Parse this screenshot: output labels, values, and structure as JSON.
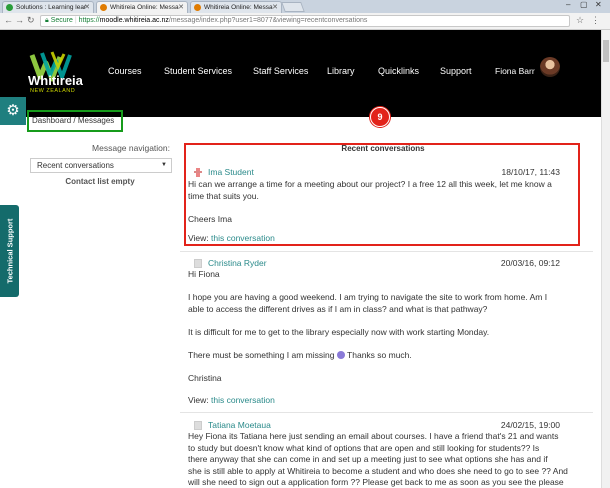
{
  "browser": {
    "tabs": [
      {
        "title": "Solutions : Learning lear",
        "fav": "#2a9d3a"
      },
      {
        "title": "Whitireia Online: Messa",
        "fav": "#e07b00"
      },
      {
        "title": "Whitireia Online: Messa",
        "fav": "#e07b00"
      }
    ],
    "url_secure": "Secure",
    "url_scheme": "https://",
    "url_host": "moodle.whitireia.ac.nz",
    "url_path": "/message/index.php?user1=8077&viewing=recentconversations"
  },
  "header": {
    "logo_text": "Whitireia",
    "logo_subtext": "NEW ZEALAND",
    "nav": [
      "Courses",
      "Student Services",
      "Staff Services",
      "Library",
      "Quicklinks",
      "Support"
    ],
    "user_name": "Fiona Barr"
  },
  "sidebar": {
    "support_label": "Technical Support"
  },
  "breadcrumb": {
    "home": "Dashboard",
    "separator": "/",
    "current": "Messages"
  },
  "message_nav": {
    "label": "Message navigation:",
    "selected": "Recent conversations",
    "empty_text": "Contact list empty"
  },
  "recent": {
    "title": "Recent conversations",
    "badge": "9",
    "view_prefix": "View:",
    "view_link": "this conversation",
    "messages": [
      {
        "sender": "Ima Student",
        "date": "18/10/17, 11:43",
        "lines": [
          "Hi can we arrange a time for a meeting about our project? I a free 12 all this week, let me know a",
          "time that suits you.",
          "",
          "Cheers Ima"
        ]
      },
      {
        "sender": "Christina Ryder",
        "date": "20/03/16, 09:12",
        "lines": [
          "Hi Fiona",
          "",
          "I hope you are having a good weekend. I am trying to navigate the site to work from home. Am I",
          "able to access the different drives as if I am in class? and what is that pathway?",
          "",
          "It is difficult for me to get to the library especially now with work starting Monday.",
          "",
          "There must be something I am missing",
          "",
          "Christina"
        ],
        "thanks": "Thanks so much."
      },
      {
        "sender": "Tatiana Moetaua",
        "date": "24/02/15, 19:00",
        "lines": [
          "Hey Fiona its Tatiana here just sending an email about courses. I have a friend that's 21 and wants",
          "to study but doesn't know what kind of options that are open and still looking for students?? Is",
          "there anyway that she can come in and set up a meeting just to see what options she has and if",
          "she is still able to apply at Whitireia to become a student and who does she need to go to see ?? And",
          "will she need to sign out a application form ?? Please get back to me as soon as you see the please"
        ]
      }
    ]
  }
}
